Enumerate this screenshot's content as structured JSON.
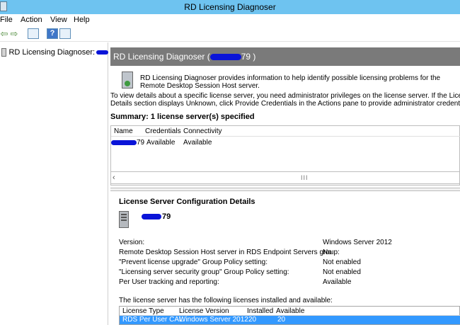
{
  "window": {
    "title": "RD Licensing Diagnoser"
  },
  "menu": [
    "File",
    "Action",
    "View",
    "Help"
  ],
  "tree": {
    "label": "RD Licensing Diagnoser:"
  },
  "header": {
    "title_prefix": "RD Licensing Diagnoser (",
    "title_suffix": "79 )"
  },
  "description": "RD Licensing Diagnoser provides information to help identify possible licensing problems for the Remote Desktop Session Host server.",
  "info": {
    "line1": "To view details about a specific license server, you need administrator privileges on the license server. If the License Server Conf",
    "line2": "Details section displays Unknown, click Provide Credentials in the Actions pane to provide administrator credentials for the license"
  },
  "summary": "Summary: 1 license server(s) specified",
  "servers_table": {
    "columns": [
      "Name",
      "Credentials",
      "Connectivity"
    ],
    "rows": [
      {
        "name": "79",
        "credentials": "Available",
        "connectivity": "Available"
      }
    ]
  },
  "scroll": {
    "grip": "III"
  },
  "details": {
    "title": "License Server Configuration Details",
    "server_name": "79",
    "properties": [
      {
        "label": "Version:",
        "value": "Windows Server 2012"
      },
      {
        "label": "Remote Desktop Session Host server in RDS Endpoint Servers group:",
        "value": "No"
      },
      {
        "label": "\"Prevent license upgrade\" Group Policy setting:",
        "value": "Not enabled"
      },
      {
        "label": "\"Licensing server security group\" Group Policy setting:",
        "value": "Not enabled"
      },
      {
        "label": "Per User tracking and reporting:",
        "value": "Available"
      }
    ],
    "licenses_note": "The license server has the following licenses installed and available:"
  },
  "licenses_table": {
    "columns": [
      "License Type",
      "License Version",
      "Installed",
      "Available"
    ],
    "rows": [
      {
        "type": "RDS Per User CAL",
        "version": "Windows Server 2012",
        "installed": "20",
        "available": "20"
      }
    ]
  },
  "colors": {
    "titlebar": "#6ec3f0",
    "header_band": "#7a7a7a",
    "selection": "#3399ff"
  },
  "icons": [
    "app-icon",
    "back-arrow-icon",
    "forward-arrow-icon",
    "console-tree-icon",
    "help-icon",
    "properties-icon",
    "server-icon",
    "diagnoser-icon"
  ]
}
